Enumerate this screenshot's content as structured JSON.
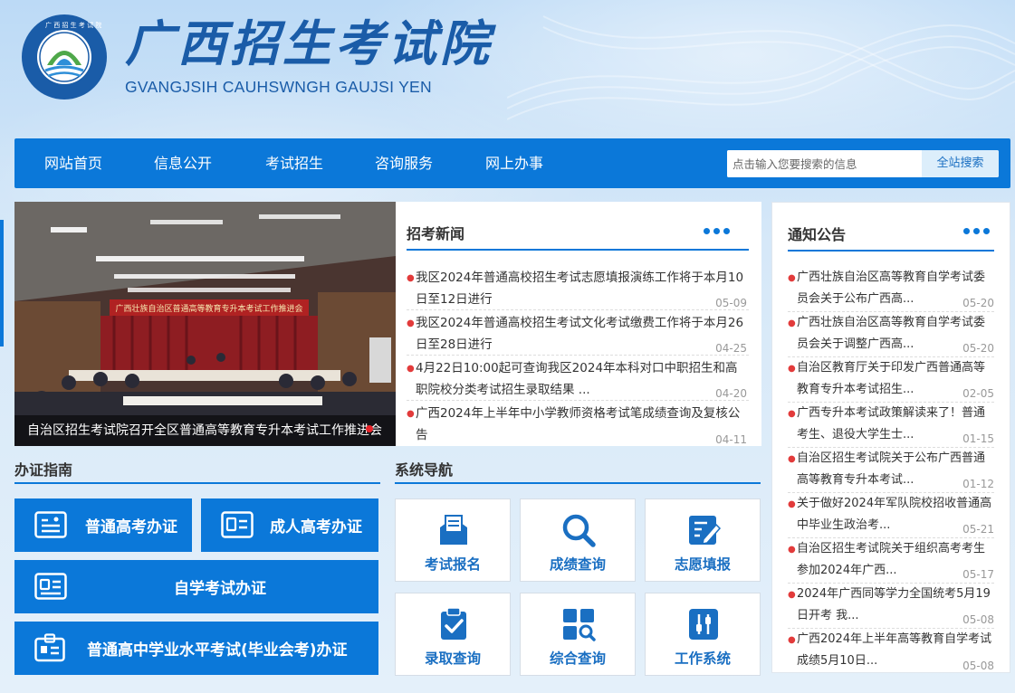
{
  "header": {
    "title": "广西招生考试院",
    "subtitle": "GVANGJSIH CAUHSWNGH GAUJSI YEN",
    "emblem_text": "广西招生考试院 GVANGJSIH CAUHSWNGH GAUJSIYEN"
  },
  "nav": {
    "items": [
      "网站首页",
      "信息公开",
      "考试招生",
      "咨询服务",
      "网上办事"
    ],
    "search_placeholder": "点击输入您要搜索的信息",
    "search_button": "全站搜索"
  },
  "slideshow": {
    "caption": "自治区招生考试院召开全区普通高等教育专升本考试工作推进会",
    "banner_text": "广西壮族自治区普通高等教育专升本考试工作推进会"
  },
  "news": {
    "title": "招考新闻",
    "items": [
      {
        "title": "我区2024年普通高校招生考试志愿填报演练工作将于本月10日至12日进行",
        "date": "05-09"
      },
      {
        "title": "我区2024年普通高校招生考试文化考试缴费工作将于本月26日至28日进行",
        "date": "04-25"
      },
      {
        "title": "4月22日10:00起可查询我区2024年本科对口中职招生和高职院校分类考试招生录取结果 ...",
        "date": "04-20"
      },
      {
        "title": "广西2024年上半年中小学教师资格考试笔成绩查询及复核公告",
        "date": "04-11"
      }
    ]
  },
  "notices": {
    "title": "通知公告",
    "items": [
      {
        "title": "广西壮族自治区高等教育自学考试委员会关于公布广西高...",
        "date": "05-20"
      },
      {
        "title": "广西壮族自治区高等教育自学考试委员会关于调整广西高...",
        "date": "05-20"
      },
      {
        "title": "自治区教育厅关于印发广西普通高等教育专升本考试招生...",
        "date": "02-05"
      },
      {
        "title": "广西专升本考试政策解读来了！普通考生、退役大学生士...",
        "date": "01-15"
      },
      {
        "title": "自治区招生考试院关于公布广西普通高等教育专升本考试...",
        "date": "01-12"
      },
      {
        "title": "关于做好2024年军队院校招收普通高中毕业生政治考...",
        "date": "05-21"
      },
      {
        "title": "自治区招生考试院关于组织高考考生参加2024年广西...",
        "date": "05-17"
      },
      {
        "title": "2024年广西同等学力全国统考5月19日开考 我...",
        "date": "05-08"
      },
      {
        "title": "广西2024年上半年高等教育自学考试成绩5月10日...",
        "date": "05-08"
      }
    ]
  },
  "guide": {
    "title": "办证指南",
    "buttons": [
      "普通高考办证",
      "成人高考办证",
      "自学考试办证",
      "普通高中学业水平考试(毕业会考)办证"
    ]
  },
  "system_nav": {
    "title": "系统导航",
    "tiles": [
      "考试报名",
      "成绩查询",
      "志愿填报",
      "录取查询",
      "综合查询",
      "工作系统"
    ]
  },
  "colors": {
    "primary": "#0b78d9",
    "logo_blue": "#1a5ca8",
    "tile_text": "#1a6fc2",
    "bullet": "#e23b3b"
  }
}
